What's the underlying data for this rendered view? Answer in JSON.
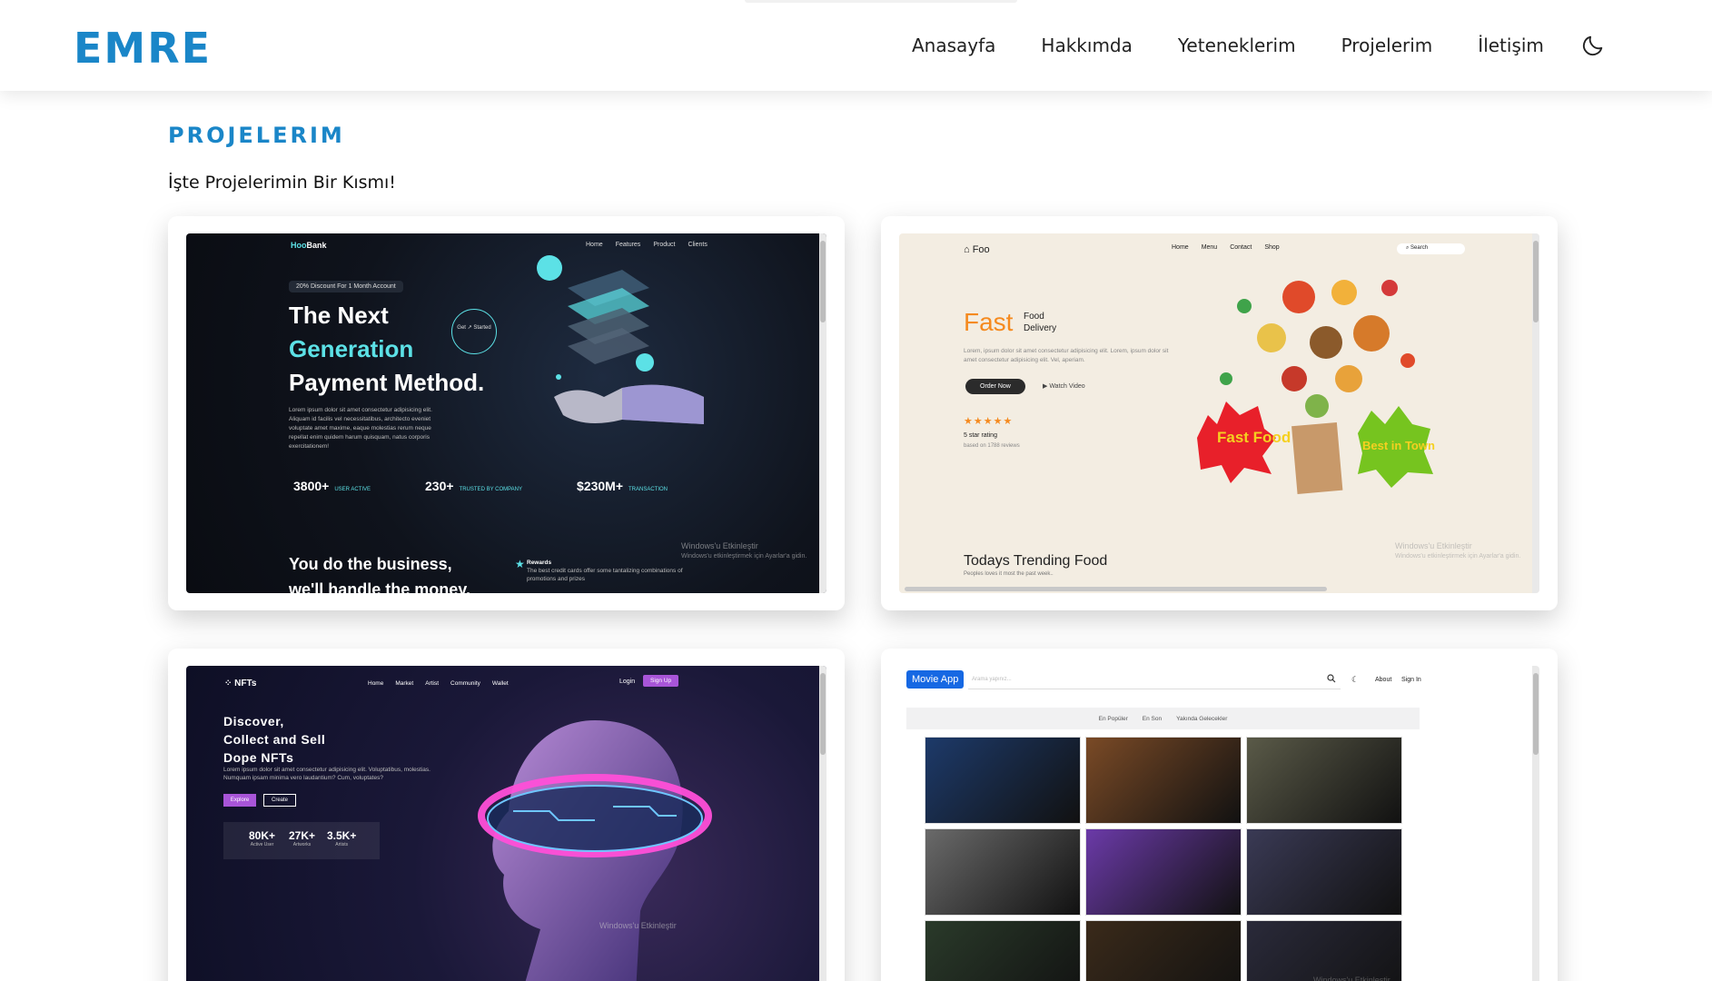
{
  "nav": {
    "logo": "EMRE",
    "menu": [
      "Anasayfa",
      "Hakkımda",
      "Yeteneklerim",
      "Projelerim",
      "İletişim"
    ],
    "theme_icon": "moon-icon"
  },
  "section": {
    "title": "PROJELERIM",
    "subtitle": "İşte Projelerimin Bir Kısmı!"
  },
  "watermark": {
    "title": "Windows'u Etkinleştir",
    "subtitle": "Windows'u etkinleştirmek için Ayarlar'a gidin."
  },
  "projects": {
    "hoobank": {
      "brand_prefix": "Hoo",
      "brand_suffix": "Bank",
      "nav": [
        "Home",
        "Features",
        "Product",
        "Clients"
      ],
      "promo": "20% Discount For 1 Month Account",
      "heading": [
        "The Next",
        "Generation",
        "Payment Method."
      ],
      "get_started": "Get ↗ Started",
      "paragraph": "Lorem ipsum dolor sit amet consectetur adipisicing elit. Aliquam id facilis vel necessitatibus, architecto eveniet voluptate amet maxime, eaque molestias rerum neque repellat enim quidem harum quisquam, natus corporis exercitationem!",
      "stats": [
        {
          "value": "3800+",
          "label": "USER ACTIVE"
        },
        {
          "value": "230+",
          "label": "TRUSTED BY COMPANY"
        },
        {
          "value": "$230M+",
          "label": "TRANSACTION"
        }
      ],
      "bottom": [
        "You do the business,",
        "we'll handle the money."
      ],
      "rewards_title": "Rewards",
      "rewards_text": "The best credit cards offer some tantalizing combinations of promotions and prizes",
      "accent": "#5ce1e6"
    },
    "foo": {
      "brand": "Foo",
      "nav": [
        "Home",
        "Menu",
        "Contact",
        "Shop"
      ],
      "search": "Search",
      "fast": "Fast",
      "food_delivery": [
        "Food",
        "Delivery"
      ],
      "paragraph": "Lorem, ipsum dolor sit amet consectetur adipisicing elit. Lorem, ipsum dolor sit amet consectetur adipisicing elit. Vel, aperiam.",
      "order_btn": "Order Now",
      "watch": "Watch Video",
      "stars": "★★★★★",
      "rating": "5 star rating",
      "reviews": "based on 1788 reviews",
      "trending": "Todays Trending Food",
      "trending_sub": "Peoples loves it most the past week..",
      "badge1": "Fast Food",
      "badge2": "Best in Town",
      "accent": "#f58a1f"
    },
    "nfts": {
      "brand": "NFTs",
      "nav": [
        "Home",
        "Market",
        "Artist",
        "Community",
        "Wallet"
      ],
      "login": "Login",
      "signup": "Sign Up",
      "heading": [
        "Discover,",
        "Collect and Sell",
        "Dope NFTs"
      ],
      "paragraph": "Lorem ipsum dolor sit amet consectetur adipisicing elit. Voluptatibus, molestias. Numquam ipsam minima vero laudantium? Cum, voluptates?",
      "explore": "Explore",
      "create": "Create",
      "stats": [
        {
          "value": "80K+",
          "label": "Active User"
        },
        {
          "value": "27K+",
          "label": "Artworks"
        },
        {
          "value": "3.5K+",
          "label": "Artists"
        }
      ],
      "accent": "#a855d8"
    },
    "movie": {
      "brand": "Movie App",
      "search_placeholder": "Arama yapınız...",
      "about": "About",
      "signin": "Sign In",
      "tabs": [
        "En Popüler",
        "En Son",
        "Yakında Gelecekler"
      ],
      "poster_colors": [
        "#1d3a6a",
        "#7a4a26",
        "#5a5a48",
        "#6a6a6a",
        "#6b3aa8",
        "#3a3a55",
        "#2a3a2a",
        "#3a2a1a",
        "#2a2a3a"
      ]
    }
  }
}
